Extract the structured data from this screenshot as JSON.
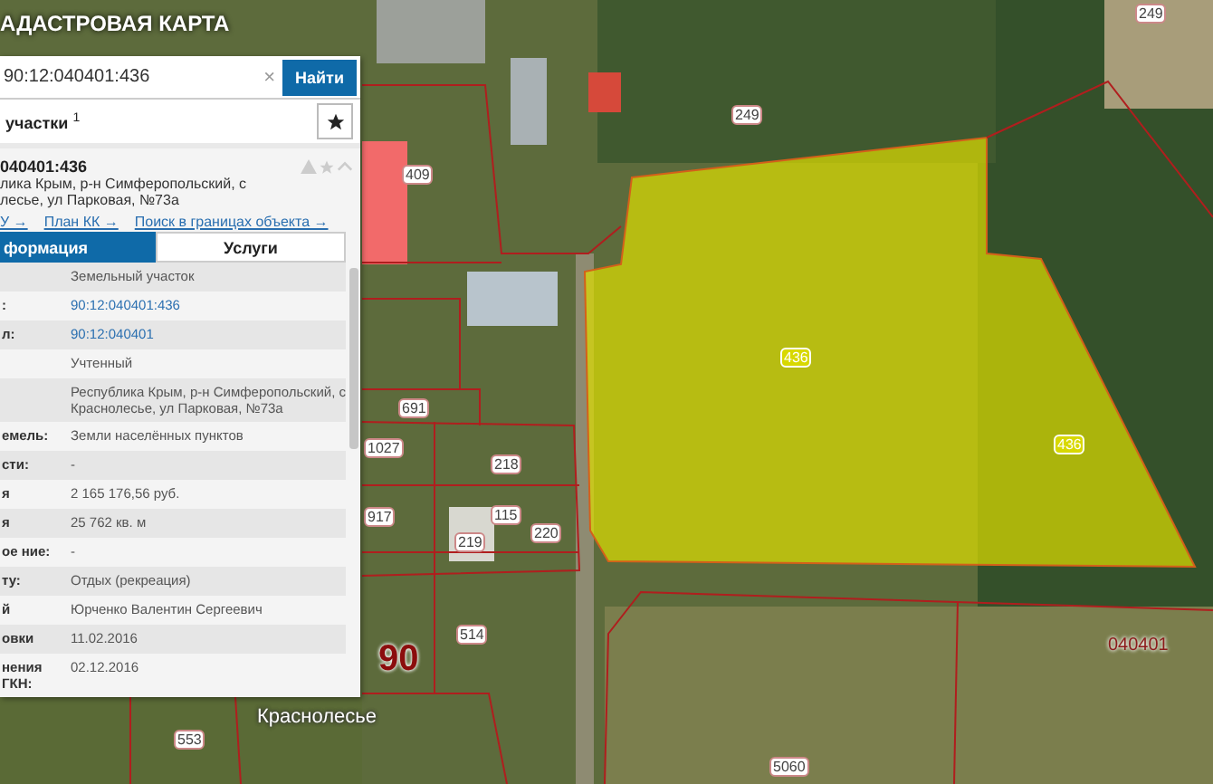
{
  "header": {
    "title": "АДАСТРОВАЯ КАРТА"
  },
  "search": {
    "value": "90:12:040401:436",
    "clear": "×",
    "button": "Найти"
  },
  "results": {
    "title": "участки $^{1}$"
  },
  "card": {
    "number": "040401:436",
    "address_lines": [
      "лика Крым, р-н Симферопольский, с",
      "лесье, ул Парковая, №73а"
    ],
    "links": [
      "У →",
      "План КК →",
      "Поиск в границах объекта →"
    ],
    "tabs": [
      {
        "label": "формация",
        "selected": true
      },
      {
        "label": "Услуги",
        "selected": false
      }
    ],
    "rows": [
      {
        "value": "Земельный участок",
        "kind": "text"
      },
      {
        "label": ":",
        "value": "90:12:040401:436",
        "kind": "link"
      },
      {
        "label": "л:",
        "value": "90:12:040401",
        "kind": "link"
      },
      {
        "value": "Учтенный",
        "kind": "text"
      },
      {
        "value": "Республика Крым, р-н Симферопольский, с Краснолесье, ул Парковая, №73а",
        "kind": "text"
      },
      {
        "label": "емель:",
        "value": "Земли населённых пунктов",
        "kind": "text"
      },
      {
        "label": "сти:",
        "value": "-",
        "kind": "text"
      },
      {
        "label": "я",
        "value": "2 165 176,56 руб.",
        "kind": "text"
      },
      {
        "label": "я",
        "value": "25 762 кв. м",
        "kind": "text"
      },
      {
        "label": "ое ние:",
        "value": "-",
        "kind": "text"
      },
      {
        "label": "ту:",
        "value": "Отдых (рекреация)",
        "kind": "text"
      },
      {
        "label": "й",
        "value": "Юрченко Валентин Сергеевич",
        "kind": "text"
      },
      {
        "label": "овки",
        "value": "11.02.2016",
        "kind": "text"
      },
      {
        "label": "нения ГКН:",
        "value": "02.12.2016",
        "kind": "text"
      }
    ]
  },
  "map": {
    "labels": [
      {
        "text": "249",
        "kind": "parcel"
      },
      {
        "text": "249",
        "kind": "parcel"
      },
      {
        "text": "409",
        "kind": "parcel"
      },
      {
        "text": "436",
        "kind": "selected"
      },
      {
        "text": "436",
        "kind": "selected"
      },
      {
        "text": "691",
        "kind": "parcel"
      },
      {
        "text": "1027",
        "kind": "parcel"
      },
      {
        "text": "218",
        "kind": "parcel"
      },
      {
        "text": "917",
        "kind": "parcel"
      },
      {
        "text": "115",
        "kind": "parcel"
      },
      {
        "text": "220",
        "kind": "parcel"
      },
      {
        "text": "219",
        "kind": "parcel"
      },
      {
        "text": "514",
        "kind": "parcel"
      },
      {
        "text": "90",
        "kind": "district"
      },
      {
        "text": "040401",
        "kind": "quarter"
      },
      {
        "text": "5060",
        "kind": "parcel"
      },
      {
        "text": "553",
        "kind": "parcel"
      },
      {
        "text": "Краснолесье",
        "kind": "place"
      }
    ]
  }
}
